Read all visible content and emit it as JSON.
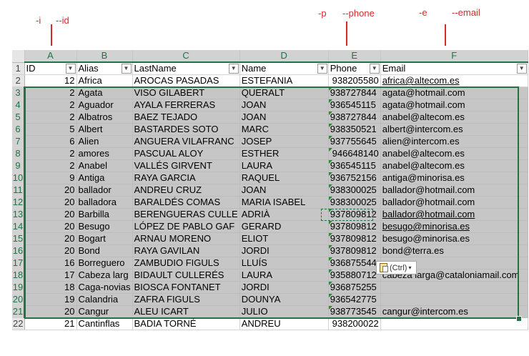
{
  "annotations": [
    {
      "id": "i",
      "text": "-i"
    },
    {
      "id": "id",
      "text": "--id"
    },
    {
      "id": "p",
      "text": "-p"
    },
    {
      "id": "phone",
      "text": "--phone"
    },
    {
      "id": "e",
      "text": "-e"
    },
    {
      "id": "email",
      "text": "--email"
    }
  ],
  "column_letters": [
    "A",
    "B",
    "C",
    "D",
    "E",
    "F"
  ],
  "headers": [
    "ID",
    "Alias",
    "LastName",
    "Name",
    "Phone",
    "Email"
  ],
  "filter_icon": "chevron-down-icon",
  "rows": [
    {
      "n": "2",
      "id": "12",
      "alias": "Africa",
      "last": "AROCAS PASADAS",
      "name": "ESTEFANIA",
      "phone": "938205580",
      "email": "africa@altecom.es"
    },
    {
      "n": "3",
      "id": "2",
      "alias": "Agata",
      "last": "VISO GILABERT",
      "name": "QUERALT",
      "phone": "938727844",
      "email": "agata@hotmail.com"
    },
    {
      "n": "4",
      "id": "2",
      "alias": "Aguador",
      "last": "AYALA FERRERAS",
      "name": "JOAN",
      "phone": "936545115",
      "email": "agata@hotmail.com"
    },
    {
      "n": "5",
      "id": "2",
      "alias": "Albatros",
      "last": "BAEZ TEJADO",
      "name": "JOAN",
      "phone": "938727844",
      "email": "anabel@altecom.es"
    },
    {
      "n": "6",
      "id": "5",
      "alias": "Albert",
      "last": "BASTARDES SOTO",
      "name": "MARC",
      "phone": "938350521",
      "email": "albert@intercom.es"
    },
    {
      "n": "7",
      "id": "6",
      "alias": "Alien",
      "last": "ANGUERA VILAFRANC",
      "name": "JOSEP",
      "phone": "937755645",
      "email": "alien@intercom.es"
    },
    {
      "n": "8",
      "id": "2",
      "alias": "amores",
      "last": "PASCUAL ALOY",
      "name": "ESTHER",
      "phone": "946648140",
      "email": "anabel@altecom.es"
    },
    {
      "n": "9",
      "id": "2",
      "alias": "Anabel",
      "last": "VALLÉS GIRVENT",
      "name": "LAURA",
      "phone": "936545115",
      "email": "anabel@altecom.es"
    },
    {
      "n": "10",
      "id": "9",
      "alias": "Antiga",
      "last": "RAYA GARCIA",
      "name": "RAQUEL",
      "phone": "936752156",
      "email": "antiga@minorisa.es"
    },
    {
      "n": "11",
      "id": "20",
      "alias": "ballador",
      "last": "ANDREU CRUZ",
      "name": "JOAN",
      "phone": "938300025",
      "email": "ballador@hotmail.com"
    },
    {
      "n": "12",
      "id": "20",
      "alias": "balladora",
      "last": "BARALDÉS COMAS",
      "name": "MARIA ISABEL",
      "phone": "938300025",
      "email": "ballador@hotmail.com"
    },
    {
      "n": "13",
      "id": "20",
      "alias": "Barbilla",
      "last": "BERENGUERAS CULLE",
      "name": "ADRIÀ",
      "phone": "937809812",
      "email": "ballador@hotmail.com"
    },
    {
      "n": "14",
      "id": "20",
      "alias": "Besugo",
      "last": "LÓPEZ DE PABLO GAF",
      "name": "GERARD",
      "phone": "937809812",
      "email": "besugo@minorisa.es"
    },
    {
      "n": "15",
      "id": "20",
      "alias": "Bogart",
      "last": "ARNAU MORENO",
      "name": "ELIOT",
      "phone": "937809812",
      "email": "besugo@minorisa.es"
    },
    {
      "n": "16",
      "id": "20",
      "alias": "Bond",
      "last": "RAYA GAVILAN",
      "name": "JORDI",
      "phone": "937809812",
      "email": "bond@terra.es"
    },
    {
      "n": "17",
      "id": "16",
      "alias": "Borreguero",
      "last": "ZAMBUDIO FIGULS",
      "name": "LLUÍS",
      "phone": "936875544",
      "email": ""
    },
    {
      "n": "18",
      "id": "17",
      "alias": "Cabeza larg",
      "last": "BIDAULT CULLERÉS",
      "name": "LAURA",
      "phone": "935880712",
      "email": "cabeza larga@cataloniamail.com"
    },
    {
      "n": "19",
      "id": "18",
      "alias": "Caga-novias",
      "last": "BIOSCA FONTANET",
      "name": "JORDI",
      "phone": "936875255",
      "email": ""
    },
    {
      "n": "20",
      "id": "19",
      "alias": "Calandria",
      "last": "ZAFRA FIGULS",
      "name": "DOUNYA",
      "phone": "936542775",
      "email": ""
    },
    {
      "n": "21",
      "id": "20",
      "alias": "Cangur",
      "last": "ALEU ICART",
      "name": "JULIO",
      "phone": "938773545",
      "email": "cangur@intercom.es"
    },
    {
      "n": "22",
      "id": "21",
      "alias": "Cantinflas",
      "last": "BADIA TORNÉ",
      "name": "ANDREU",
      "phone": "938200022",
      "email": ""
    }
  ],
  "paste_options": {
    "label": "(Ctrl)",
    "icon": "clipboard-icon",
    "dropdown_icon": "chevron-down-icon"
  },
  "colors": {
    "selection_border": "#217346",
    "selection_fill": "#c6c6c6",
    "annotation": "#d62a2a"
  }
}
